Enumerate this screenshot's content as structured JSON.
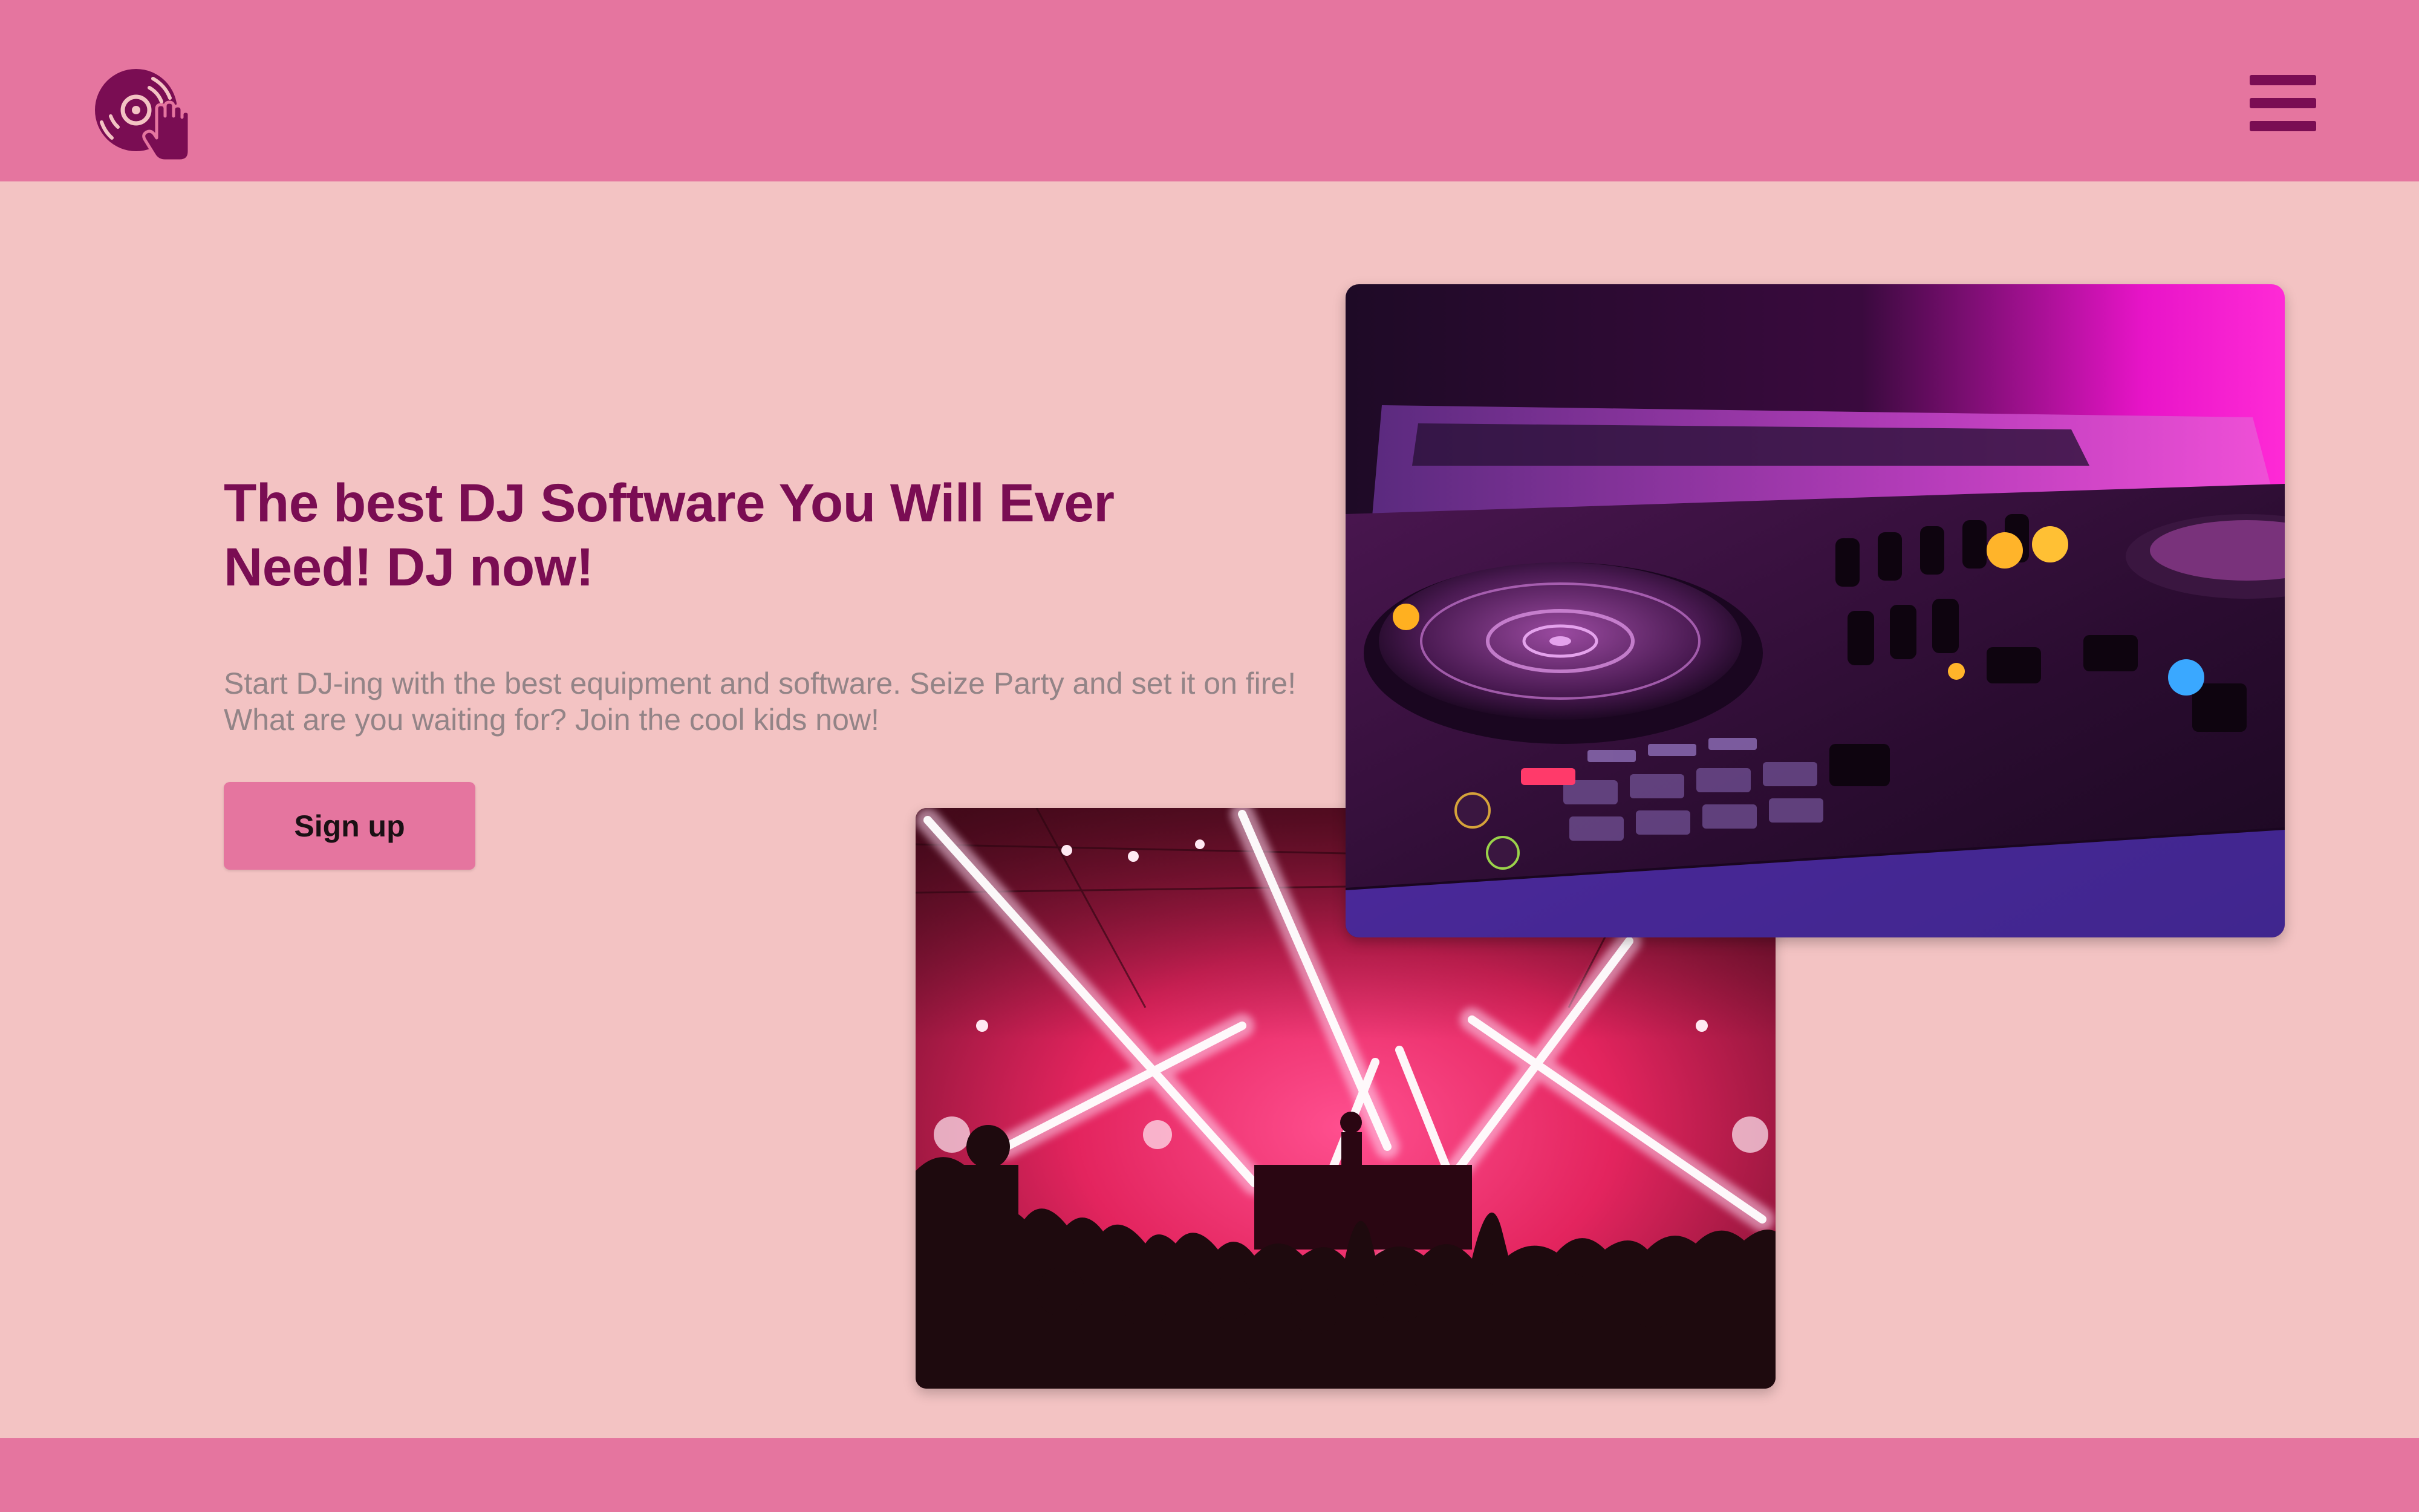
{
  "header": {
    "logo_icon": "dj-turntable-hand-icon",
    "menu_icon": "hamburger-menu-icon"
  },
  "hero": {
    "title": "The best DJ Software You Will Ever Need! DJ now!",
    "description": "Start DJ-ing with the best equipment and software. Seize Party and set it on fire! What are you waiting for? Join the cool kids now!",
    "signup_label": "Sign up"
  },
  "images": {
    "mixer_alt": "DJ controller with laptop in pink light",
    "crowd_alt": "Concert crowd under pink stage lights"
  },
  "colors": {
    "background": "#f3c3c3",
    "header": "#e5759f",
    "accent": "#7a0d53",
    "button": "#e5759f",
    "body_text": "#938487"
  }
}
